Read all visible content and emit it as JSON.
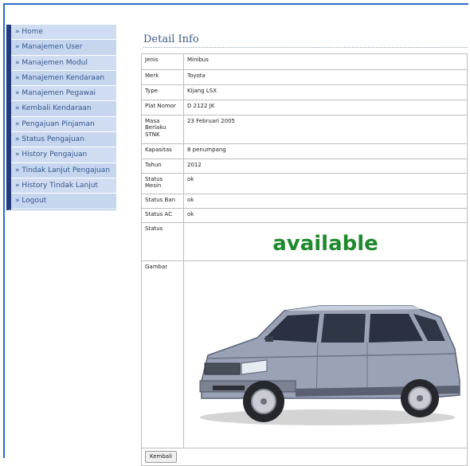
{
  "sidebar": {
    "items": [
      {
        "label": "» Home"
      },
      {
        "label": "» Manajemen User"
      },
      {
        "label": "» Manajemen Modul"
      },
      {
        "label": "» Manajemen Kendaraan"
      },
      {
        "label": "» Manajemen Pegawai"
      },
      {
        "label": "» Kembali Kendaraan"
      },
      {
        "label": "» Pengajuan Pinjaman"
      },
      {
        "label": "» Status Pengajuan"
      },
      {
        "label": "» History Pengajuan"
      },
      {
        "label": "» Tindak Lanjut Pengajuan"
      },
      {
        "label": "» History Tindak Lanjut"
      },
      {
        "label": "» Logout"
      }
    ]
  },
  "main": {
    "title": "Detail Info",
    "rows": [
      {
        "label": "Jenis",
        "value": "Minibus"
      },
      {
        "label": "Merk",
        "value": "Toyota"
      },
      {
        "label": "Type",
        "value": "Kijang LSX"
      },
      {
        "label": "Plat Nomor",
        "value": "D 2122 JK"
      },
      {
        "label": "Masa Berlaku STNK",
        "value": "23 Februari 2005"
      },
      {
        "label": "Kapasitas",
        "value": "8 penumpang"
      },
      {
        "label": "Tahun",
        "value": "2012"
      },
      {
        "label": "Status Mesin",
        "value": "ok"
      },
      {
        "label": "Status Ban",
        "value": "ok"
      },
      {
        "label": "Status AC",
        "value": "ok"
      }
    ],
    "status_label": "Status",
    "status_value": "available",
    "image_label": "Gambar",
    "back_button": "Kembali"
  },
  "colors": {
    "status_green": "#1f8a2c",
    "sidebar_bg": "#c9d8ee",
    "sidebar_accent": "#233b7a",
    "link_text": "#35588f"
  }
}
